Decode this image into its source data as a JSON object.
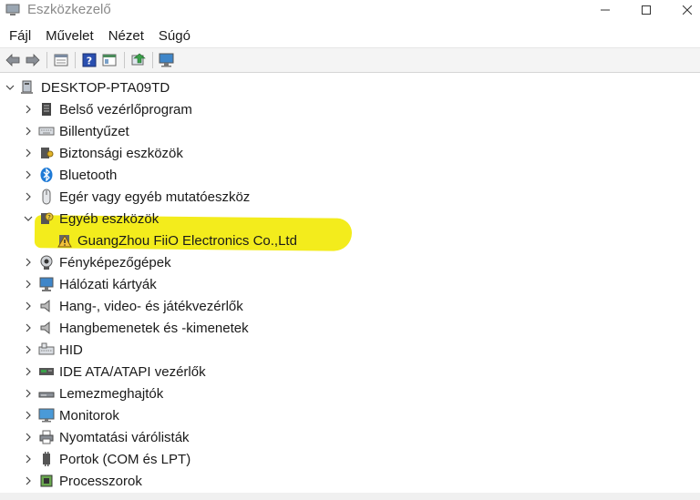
{
  "window": {
    "title": "Eszközkezelő"
  },
  "menu": [
    "Fájl",
    "Művelet",
    "Nézet",
    "Súgó"
  ],
  "toolbar": {
    "icons": [
      "back-arrow-icon",
      "forward-arrow-icon",
      "properties-icon",
      "help-icon",
      "view-icon",
      "update-driver-icon",
      "scan-hardware-icon"
    ]
  },
  "tree": {
    "root": "DESKTOP-PTA09TD",
    "categories": [
      {
        "label": "Belső vezérlőprogram",
        "icon": "firmware-icon"
      },
      {
        "label": "Billentyűzet",
        "icon": "keyboard-icon"
      },
      {
        "label": "Biztonsági eszközök",
        "icon": "security-device-icon"
      },
      {
        "label": "Bluetooth",
        "icon": "bluetooth-icon"
      },
      {
        "label": "Egér vagy egyéb mutatóeszköz",
        "icon": "mouse-icon"
      },
      {
        "label": "Egyéb eszközök",
        "icon": "unknown-device-icon",
        "expanded": true,
        "children": [
          {
            "label": "GuangZhou FiiO Electronics Co.,Ltd",
            "icon": "warning-device-icon"
          }
        ]
      },
      {
        "label": "Fényképezőgépek",
        "icon": "camera-icon"
      },
      {
        "label": "Hálózati kártyák",
        "icon": "network-adapter-icon"
      },
      {
        "label": "Hang-, video- és játékvezérlők",
        "icon": "speaker-icon"
      },
      {
        "label": "Hangbemenetek és -kimenetek",
        "icon": "audio-io-icon"
      },
      {
        "label": "HID",
        "icon": "hid-icon"
      },
      {
        "label": "IDE ATA/ATAPI vezérlők",
        "icon": "ide-controller-icon"
      },
      {
        "label": "Lemezmeghajtók",
        "icon": "disk-drive-icon"
      },
      {
        "label": "Monitorok",
        "icon": "monitor-icon"
      },
      {
        "label": "Nyomtatási várólisták",
        "icon": "printer-icon"
      },
      {
        "label": "Portok (COM és LPT)",
        "icon": "port-icon"
      },
      {
        "label": "Processzorok",
        "icon": "processor-icon"
      }
    ]
  },
  "colors": {
    "highlight": "#f3ec1c",
    "accent": "#1e7ad6"
  }
}
